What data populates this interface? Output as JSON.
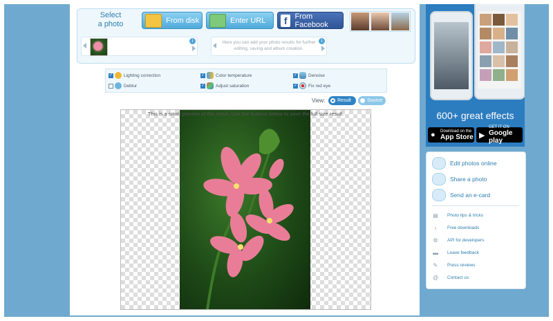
{
  "upload": {
    "select_label": "Select\na photo",
    "from_disk": "From disk",
    "enter_url": "Enter URL",
    "from_facebook": "From Facebook",
    "hint": "Here you can add your photo results for further editing, saving and album creation."
  },
  "options": [
    {
      "label": "Lighting correction",
      "checked": true
    },
    {
      "label": "Color temperature",
      "checked": true
    },
    {
      "label": "Denoise",
      "checked": true
    },
    {
      "label": "Deblur",
      "checked": false
    },
    {
      "label": "Adjust saturation",
      "checked": true
    },
    {
      "label": "Fix red eye",
      "checked": true
    }
  ],
  "view": {
    "label": "View:",
    "result": "Result",
    "source": "Source"
  },
  "preview": {
    "notice": "This is a small preview of the result. Use the buttons below to save the full size result."
  },
  "promo": {
    "headline": "600+ great effects",
    "appstore_top": "Download on the",
    "appstore_bottom": "App Store",
    "googleplay_top": "GET IT ON",
    "googleplay_bottom": "Google play"
  },
  "sidebar": {
    "main_links": [
      "Edit photos online",
      "Share a photo",
      "Send an e-card"
    ],
    "small_links": [
      "Photo tips & tricks",
      "Free downloads",
      "API for developers",
      "Leave feedback",
      "Press reviews",
      "Contact us"
    ]
  }
}
